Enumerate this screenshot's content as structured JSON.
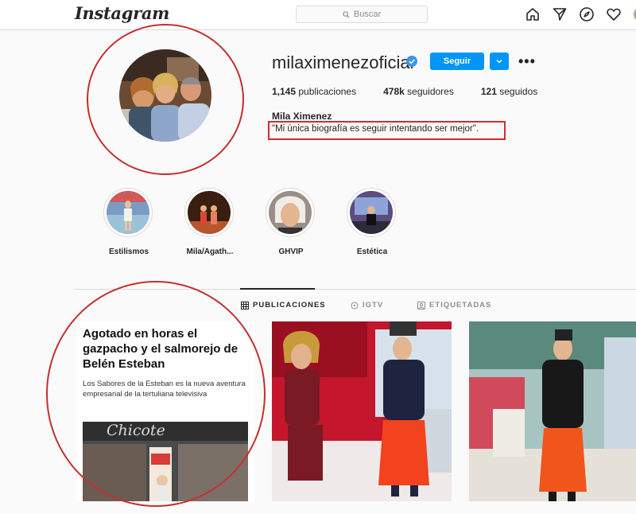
{
  "topbar": {
    "logo": "Instagram",
    "search_placeholder": "Buscar",
    "icons": [
      "home-icon",
      "direct-icon",
      "explore-icon",
      "heart-icon",
      "avatar"
    ]
  },
  "profile": {
    "username": "milaximenezoficial",
    "verified": true,
    "follow_label": "Seguir",
    "stats": {
      "posts_count": "1,145",
      "posts_label": "publicaciones",
      "followers_count": "478k",
      "followers_label": "seguidores",
      "following_count": "121",
      "following_label": "seguidos"
    },
    "full_name": "Mila Ximenez",
    "bio": "\"Mi única biografía es seguir intentando ser mejor\"."
  },
  "highlights": [
    {
      "label": "Estilismos"
    },
    {
      "label": "Mila/Agath..."
    },
    {
      "label": "GHVIP"
    },
    {
      "label": "Estética"
    }
  ],
  "tabs": [
    {
      "label": "PUBLICACIONES",
      "active": true
    },
    {
      "label": "IGTV",
      "active": false
    },
    {
      "label": "ETIQUETADAS",
      "active": false
    }
  ],
  "posts": {
    "article_title": "Agotado en horas el gazpacho y el salmorejo de Belén Esteban",
    "article_subtitle": "Los Sabores de la Esteban es la nueva aventura empresarial de la tertuliana televisiva",
    "article_sign": "Chicote"
  },
  "colors": {
    "accent": "#0095f6",
    "annotation_red": "#c62f2f"
  }
}
